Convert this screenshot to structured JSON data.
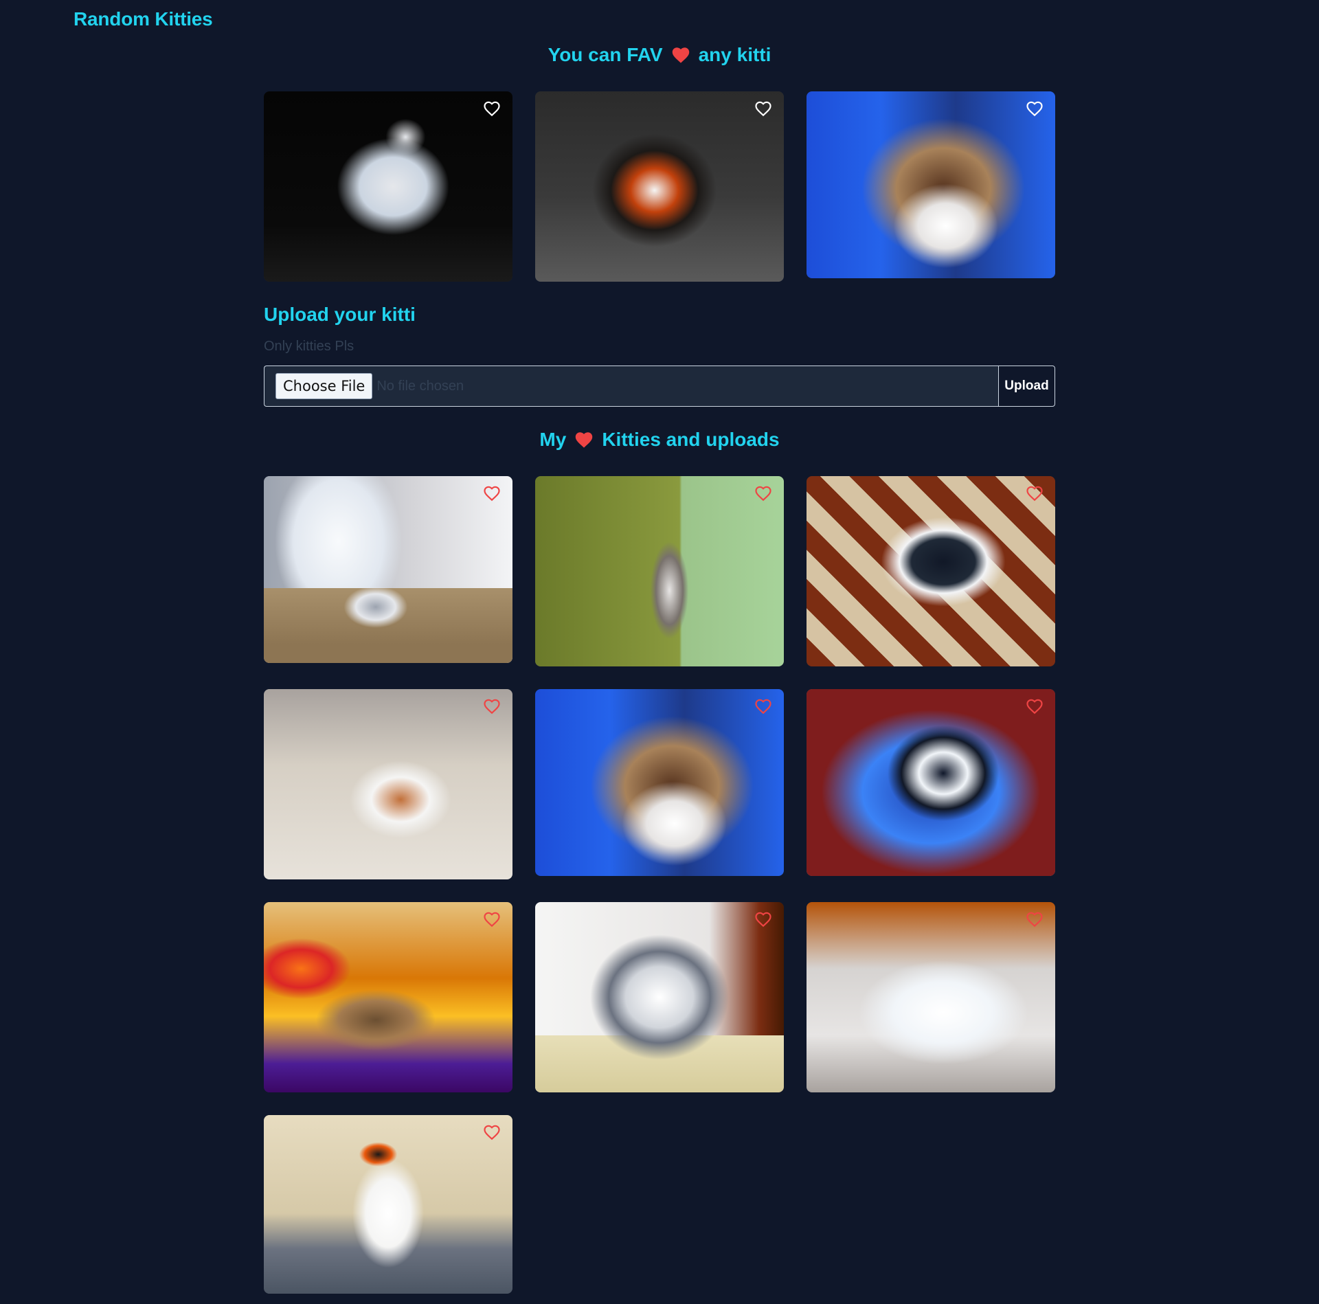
{
  "brand": {
    "title": "Random Kitties"
  },
  "random_section": {
    "title_before": "You can FAV",
    "title_after": "any kitti",
    "cards": [
      {
        "subject": "white kitten on black backdrop",
        "fav_icon": "heart-outline-white"
      },
      {
        "subject": "calico kitten yawning",
        "fav_icon": "heart-outline-white"
      },
      {
        "subject": "grumpy cat on blue background",
        "fav_icon": "heart-outline-white"
      }
    ]
  },
  "upload": {
    "title": "Upload your kitti",
    "hint": "Only kitties Pls",
    "choose_label": "Choose File",
    "status": "No file chosen",
    "button_label": "Upload"
  },
  "favs_section": {
    "title_before": "My",
    "title_after": "Kitties and uploads",
    "cards": [
      {
        "subject": "white cat with kitten in box",
        "fav_icon": "heart-outline-red"
      },
      {
        "subject": "kittens peeking from green wall",
        "fav_icon": "heart-outline-red"
      },
      {
        "subject": "black and white cat on rug",
        "fav_icon": "heart-outline-red"
      },
      {
        "subject": "orange and white cat sitting on floor",
        "fav_icon": "heart-outline-red"
      },
      {
        "subject": "grumpy cat on blue background",
        "fav_icon": "heart-outline-red"
      },
      {
        "subject": "black and white cat in basket",
        "fav_icon": "heart-outline-red"
      },
      {
        "subject": "tabby cat at fruit market",
        "fav_icon": "heart-outline-red"
      },
      {
        "subject": "tabby cat wearing headscarf",
        "fav_icon": "heart-outline-red"
      },
      {
        "subject": "white persian cat lying down",
        "fav_icon": "heart-outline-red"
      },
      {
        "subject": "calico cat sitting on cushion",
        "fav_icon": "heart-outline-red"
      }
    ]
  },
  "colors": {
    "background": "#0f172a",
    "accent": "#22d3ee",
    "heart": "#ef4444",
    "muted": "#334155"
  }
}
